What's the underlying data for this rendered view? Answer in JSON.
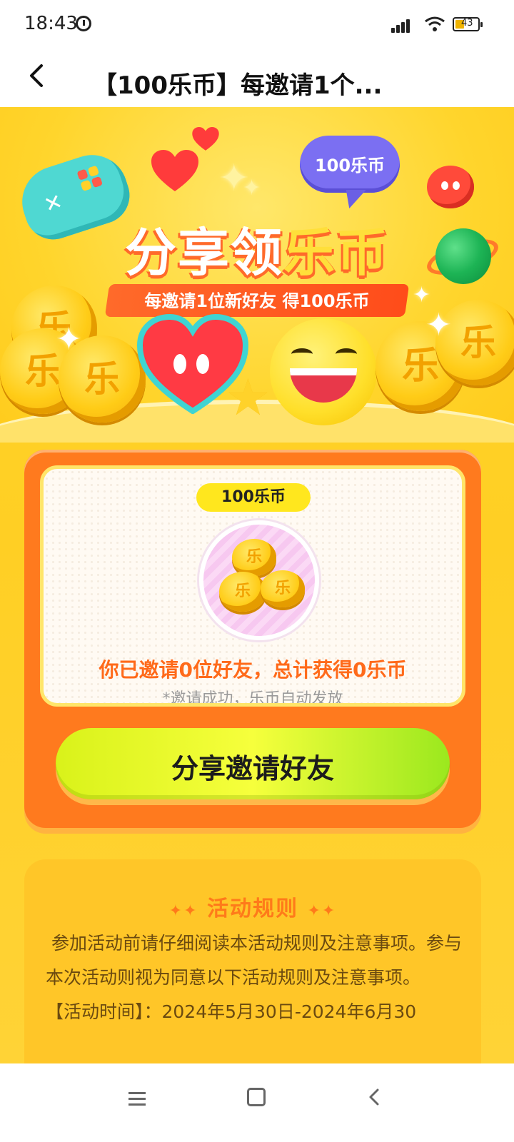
{
  "status_bar": {
    "time": "18:43",
    "battery": "43"
  },
  "header": {
    "title": "【100乐币】每邀请1个..."
  },
  "hero": {
    "bubble_text": "100乐币",
    "title_part1": "分享领",
    "title_part2": "乐币",
    "subtitle": "每邀请1位新好友 得100乐币",
    "coin_char": "乐"
  },
  "invite_card": {
    "reward_label": "100乐币",
    "status_text": "你已邀请0位好友，总计获得0乐币",
    "note": "*邀请成功，乐币自动发放",
    "share_button": "分享邀请好友"
  },
  "rules": {
    "title": "活动规则",
    "paragraph": "参加活动前请仔细阅读本活动规则及注意事项。参与本次活动则视为同意以下活动规则及注意事项。",
    "time_line": "【活动时间】：2024年5月30日-2024年6月30"
  },
  "colors": {
    "accent_orange": "#ff7a1e",
    "background_yellow": "#ffd42a",
    "button_green": "#d9f21a"
  },
  "icons": {
    "back": "chevron-left-icon",
    "alarm": "alarm-icon",
    "signal": "signal-icon",
    "wifi": "wifi-icon",
    "battery": "battery-icon",
    "nav_menu": "menu-icon",
    "nav_home": "home-square-icon",
    "nav_back": "back-triangle-icon"
  }
}
